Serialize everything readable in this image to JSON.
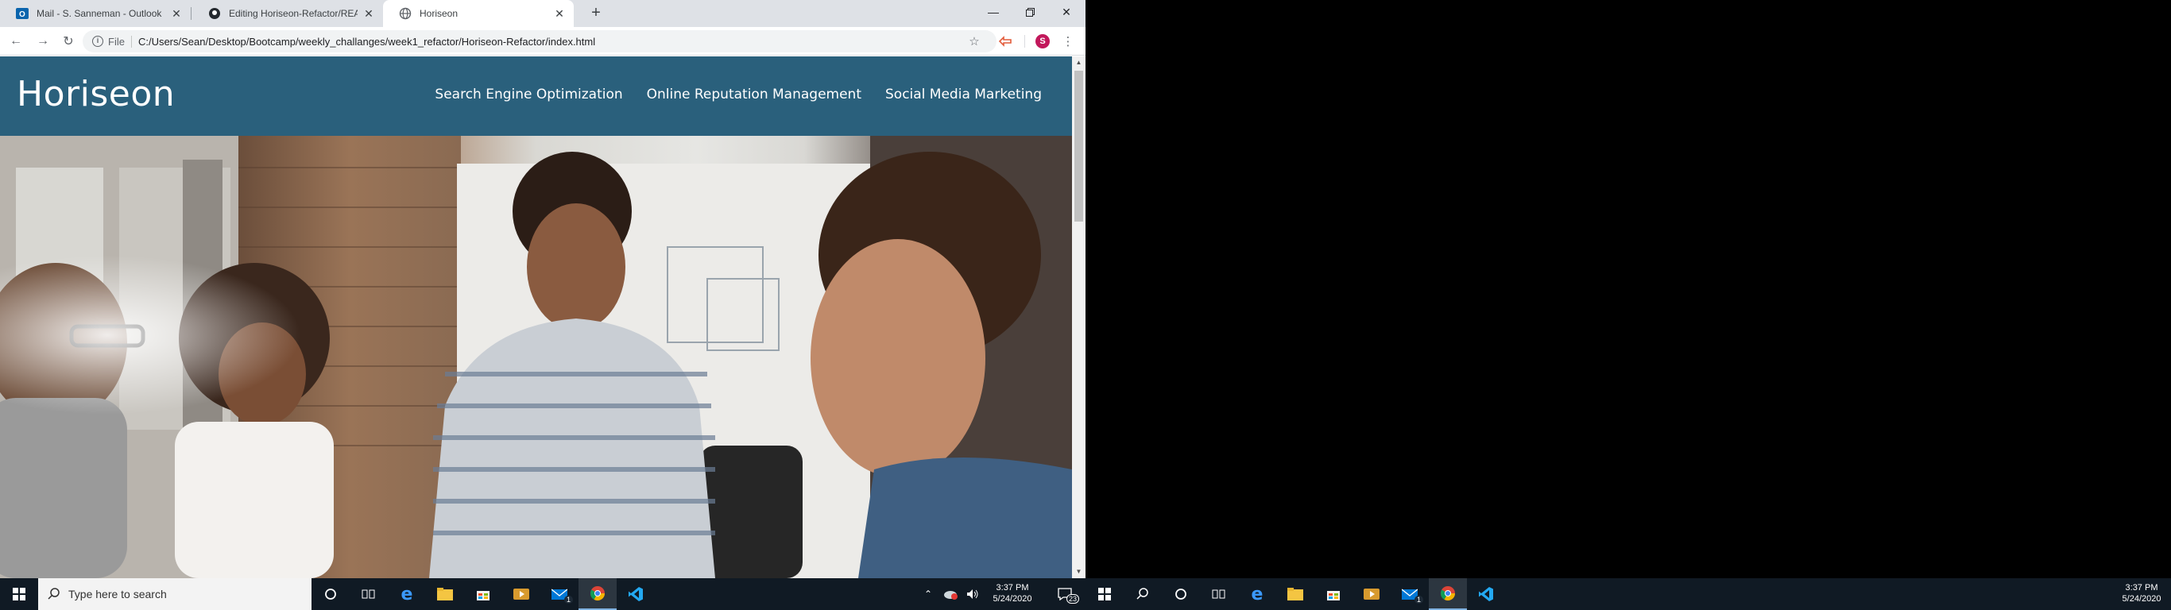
{
  "browser": {
    "tabs": [
      {
        "title": "Mail - S. Sanneman - Outlook",
        "icon": "outlook-icon"
      },
      {
        "title": "Editing Horiseon-Refactor/README",
        "icon": "github-icon"
      },
      {
        "title": "Horiseon",
        "icon": "globe-icon",
        "active": true
      }
    ],
    "new_tab": "+",
    "omnibox": {
      "scheme": "File",
      "url": "C:/Users/Sean/Desktop/Bootcamp/weekly_challanges/week1_refactor/Horiseon-Refactor/index.html"
    },
    "profile_initial": "S"
  },
  "page": {
    "logo": "Horiseon",
    "nav": [
      "Search Engine Optimization",
      "Online Reputation Management",
      "Social Media Marketing"
    ],
    "header_color": "#2a607c"
  },
  "taskbar": {
    "search_placeholder": "Type here to search",
    "time": "3:37 PM",
    "date": "5/24/2020",
    "notification_count": "23",
    "mail_badge": "1"
  },
  "taskbar_right": {
    "time": "3:37 PM",
    "date": "5/24/2020",
    "mail_badge": "1"
  }
}
